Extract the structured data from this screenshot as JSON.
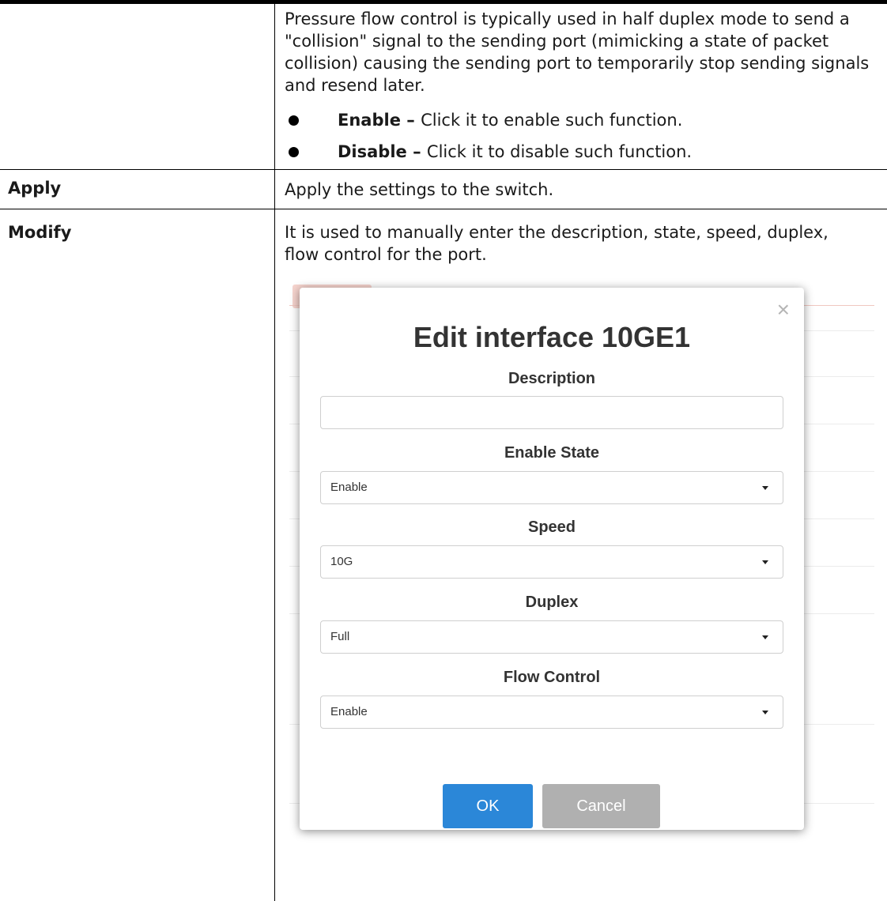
{
  "rows": {
    "pressure": {
      "description": "Pressure flow control is typically used in half duplex mode to send a \"collision\" signal to the sending port (mimicking a state of packet collision) causing the sending port to temporarily stop sending signals and resend later.",
      "bullets": [
        {
          "term": "Enable",
          "sep": " – ",
          "text": "Click it to enable such function."
        },
        {
          "term": "Disable",
          "sep": " – ",
          "text": "Click it to disable such function."
        }
      ]
    },
    "apply": {
      "label": "Apply",
      "description": "Apply the settings to the switch."
    },
    "modify": {
      "label": "Modify",
      "description": "It is used to manually enter the description, state, speed, duplex, flow control for the port."
    }
  },
  "dialog": {
    "title": "Edit interface 10GE1",
    "close_symbol": "×",
    "fields": {
      "description": {
        "label": "Description",
        "value": ""
      },
      "enable_state": {
        "label": "Enable State",
        "value": "Enable"
      },
      "speed": {
        "label": "Speed",
        "value": "10G"
      },
      "duplex": {
        "label": "Duplex",
        "value": "Full"
      },
      "flow_control": {
        "label": "Flow Control",
        "value": "Enable"
      }
    },
    "ok_label": "OK",
    "cancel_label": "Cancel"
  },
  "colors": {
    "ok_button": "#2b87d8",
    "cancel_button": "#b0b0b0"
  }
}
